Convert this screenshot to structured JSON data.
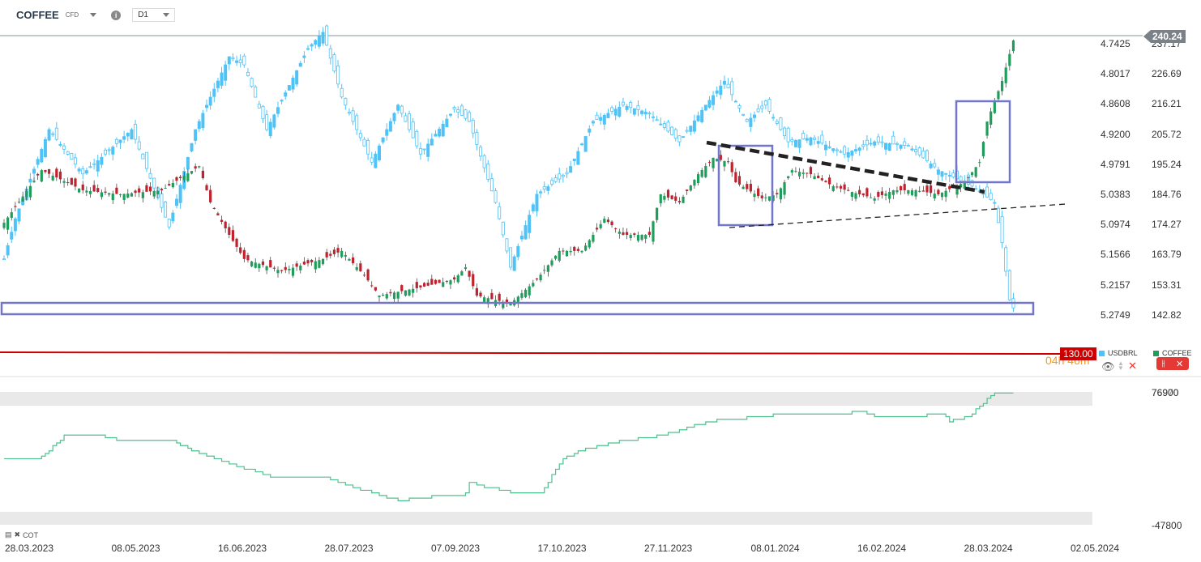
{
  "header": {
    "symbol": "COFFEE",
    "type": "CFD",
    "timeframe": "D1"
  },
  "right_axis": [
    "237.17",
    "226.69",
    "216.21",
    "205.72",
    "195.24",
    "184.76",
    "174.27",
    "163.79",
    "153.31",
    "142.82"
  ],
  "left_axis": [
    "4.7425",
    "4.8017",
    "4.8608",
    "4.9200",
    "4.9791",
    "5.0383",
    "5.0974",
    "5.1566",
    "5.2157",
    "5.2749"
  ],
  "current_price": "240.24",
  "alert_price": "130.00",
  "countdown": "04h 46m",
  "legend": {
    "usdbrl": "USDBRL",
    "coffee": "COFFEE"
  },
  "colors": {
    "up": "#1e9e5a",
    "down": "#c0232d",
    "usdbrl": "#4fc3f7",
    "cot": "#4fc08d",
    "box": "#7276c9",
    "alert": "#cc0000"
  },
  "cot": {
    "label": "COT",
    "top_value": "76900",
    "top_value2": "76970",
    "bottom_value": "-47800"
  },
  "x_axis": [
    "28.03.2023",
    "08.05.2023",
    "16.06.2023",
    "28.07.2023",
    "07.09.2023",
    "17.10.2023",
    "27.11.2023",
    "08.01.2024",
    "16.02.2024",
    "28.03.2024",
    "02.05.2024"
  ],
  "chart_data": {
    "type": "candlestick",
    "bars": 270,
    "coffee_keypoints": [
      [
        0,
        174.9
      ],
      [
        10,
        193.2
      ],
      [
        21,
        186.2
      ],
      [
        31,
        184.8
      ],
      [
        42,
        186.2
      ],
      [
        52,
        194.6
      ],
      [
        55,
        182
      ],
      [
        60,
        170.7
      ],
      [
        64,
        162.3
      ],
      [
        74,
        158.1
      ],
      [
        85,
        162.3
      ],
      [
        90,
        165.1
      ],
      [
        96,
        156.6
      ],
      [
        100,
        149.6
      ],
      [
        111,
        152.4
      ],
      [
        120,
        155.2
      ],
      [
        123,
        159.4
      ],
      [
        126,
        149.6
      ],
      [
        135,
        146.8
      ],
      [
        142,
        155.2
      ],
      [
        148,
        165.1
      ],
      [
        154,
        165.1
      ],
      [
        160,
        176.3
      ],
      [
        165,
        170.7
      ],
      [
        172,
        170.7
      ],
      [
        175,
        184.8
      ],
      [
        180,
        182
      ],
      [
        185,
        191.8
      ],
      [
        189,
        197.5
      ],
      [
        193,
        196
      ],
      [
        195,
        189
      ],
      [
        202,
        183.4
      ],
      [
        206,
        184.8
      ],
      [
        210,
        193.2
      ],
      [
        215,
        191.8
      ],
      [
        221,
        187.6
      ],
      [
        228,
        184.8
      ],
      [
        232,
        183.4
      ],
      [
        237,
        186.2
      ],
      [
        243,
        186.2
      ],
      [
        249,
        184.8
      ],
      [
        256,
        189
      ],
      [
        260,
        196
      ],
      [
        262,
        210.1
      ],
      [
        266,
        224.2
      ],
      [
        269,
        238.3
      ]
    ],
    "usdbrl_keypoints": [
      [
        0,
        5.165
      ],
      [
        3,
        5.086
      ],
      [
        12,
        4.911
      ],
      [
        21,
        4.998
      ],
      [
        27,
        4.959
      ],
      [
        34,
        4.911
      ],
      [
        44,
        5.102
      ],
      [
        51,
        4.911
      ],
      [
        60,
        4.768
      ],
      [
        64,
        4.784
      ],
      [
        70,
        4.911
      ],
      [
        81,
        4.752
      ],
      [
        85,
        4.72
      ],
      [
        90,
        4.847
      ],
      [
        98,
        4.975
      ],
      [
        105,
        4.863
      ],
      [
        111,
        4.959
      ],
      [
        120,
        4.871
      ],
      [
        124,
        4.895
      ],
      [
        131,
        5.054
      ],
      [
        135,
        5.181
      ],
      [
        142,
        5.038
      ],
      [
        150,
        4.998
      ],
      [
        157,
        4.895
      ],
      [
        165,
        4.863
      ],
      [
        172,
        4.879
      ],
      [
        180,
        4.935
      ],
      [
        187,
        4.863
      ],
      [
        192,
        4.816
      ],
      [
        198,
        4.895
      ],
      [
        203,
        4.863
      ],
      [
        209,
        4.935
      ],
      [
        215,
        4.927
      ],
      [
        224,
        4.959
      ],
      [
        232,
        4.935
      ],
      [
        241,
        4.943
      ],
      [
        249,
        4.99
      ],
      [
        258,
        5.022
      ],
      [
        264,
        5.054
      ],
      [
        266,
        5.133
      ],
      [
        268,
        5.245
      ],
      [
        269,
        5.261
      ]
    ],
    "cot_keypoints": [
      [
        0,
        15350
      ],
      [
        9,
        13800
      ],
      [
        16,
        36920
      ],
      [
        26,
        36920
      ],
      [
        32,
        31530
      ],
      [
        45,
        31530
      ],
      [
        52,
        19980
      ],
      [
        64,
        6110
      ],
      [
        71,
        -1590
      ],
      [
        86,
        -3130
      ],
      [
        99,
        -18540
      ],
      [
        105,
        -24700
      ],
      [
        112,
        -21620
      ],
      [
        123,
        -18540
      ],
      [
        124,
        -7750
      ],
      [
        129,
        -12370
      ],
      [
        138,
        -18540
      ],
      [
        143,
        -18540
      ],
      [
        149,
        16120
      ],
      [
        155,
        23830
      ],
      [
        164,
        31530
      ],
      [
        172,
        35380
      ],
      [
        179,
        40770
      ],
      [
        188,
        50780
      ],
      [
        198,
        53860
      ],
      [
        207,
        56940
      ],
      [
        215,
        58490
      ],
      [
        225,
        58490
      ],
      [
        228,
        60030
      ],
      [
        233,
        53860
      ],
      [
        241,
        55400
      ],
      [
        250,
        56940
      ],
      [
        252,
        50780
      ],
      [
        257,
        55400
      ],
      [
        261,
        68500
      ],
      [
        264,
        76900
      ],
      [
        270,
        76900
      ]
    ],
    "right_range": [
      142.82,
      237.17
    ],
    "left_range": [
      4.7425,
      5.2749
    ],
    "cot_range": [
      -47800,
      76970
    ]
  }
}
